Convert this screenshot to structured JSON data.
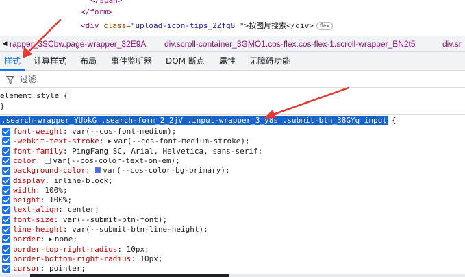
{
  "dom": {
    "line1": "</span>",
    "line2": "</form>",
    "line3_tag_open": "<div ",
    "line3_attr": "class=",
    "line3_val": "\"upload-icon-tips_2Zfq8 \"",
    "line3_text": ">按图片搜索</div>",
    "line3_badge": "flex"
  },
  "breadcrumb": {
    "scroll_glyph": "◀",
    "items": [
      "rapper_3SCbw.page-wrapper_32E9A",
      "div.scroll-container_3GMO1.cos-flex.cos-flex-1.scroll-wrapper_BN2t5",
      "div.sr"
    ]
  },
  "tabs": [
    "样式",
    "计算样式",
    "布局",
    "事件监听器",
    "DOM 断点",
    "属性",
    "无障碍功能"
  ],
  "filter": {
    "label": "过滤"
  },
  "element_style": {
    "open": "element.style {",
    "close": "}"
  },
  "rule": {
    "selector": ".search-wrapper_YUbkG .search-form_2_2jV .input-wrapper_3_y8s .submit-btn_38GYq input",
    "open_brace": "{",
    "declarations": [
      {
        "prop": "font-weight",
        "value": "var(--cos-font-medium);"
      },
      {
        "prop": "-webkit-text-stroke",
        "value": "var(--cos-font-medium-stroke);"
      },
      {
        "prop": "font-family",
        "value": "PingFang SC, Arial, Helvetica, sans-serif;"
      },
      {
        "prop": "color",
        "value": "var(--cos-color-text-on-em);"
      },
      {
        "prop": "background-color",
        "value": "var(--cos-color-bg-primary);"
      },
      {
        "prop": "display",
        "value": "inline-block;"
      },
      {
        "prop": "width",
        "value": "100%;"
      },
      {
        "prop": "height",
        "value": "100%;"
      },
      {
        "prop": "text-align",
        "value": "center;"
      },
      {
        "prop": "font-size",
        "value": "var(--submit-btn-font);"
      },
      {
        "prop": "line-height",
        "value": "var(--submit-btn-line-height);"
      },
      {
        "prop": "border",
        "value": "none;"
      },
      {
        "prop": "border-top-right-radius",
        "value": "10px;"
      },
      {
        "prop": "border-bottom-right-radius",
        "value": "10px;"
      },
      {
        "prop": "cursor",
        "value": "pointer;"
      }
    ]
  },
  "colors": {
    "accent": "#1a73e8",
    "selector_highlight": "#1a63c9",
    "annotation_arrow": "#e53935",
    "swatch_text_on_em": "#ffffff",
    "swatch_bg_primary": "#4e6ef2"
  }
}
